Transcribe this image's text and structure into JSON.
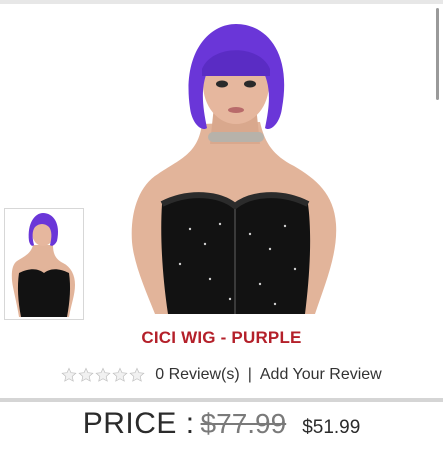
{
  "product": {
    "title": "CICI WIG - PURPLE"
  },
  "reviews": {
    "stars_filled": 0,
    "stars_total": 5,
    "count_text": "0 Review(s)",
    "separator": "|",
    "add_text": "Add Your Review"
  },
  "pricing": {
    "label": "PRICE :",
    "original": "$77.99",
    "sale": "$51.99"
  },
  "colors": {
    "title": "#b4202a",
    "wig": "#6a36d8",
    "corset": "#111111"
  },
  "icons": {
    "star": "star-icon"
  }
}
